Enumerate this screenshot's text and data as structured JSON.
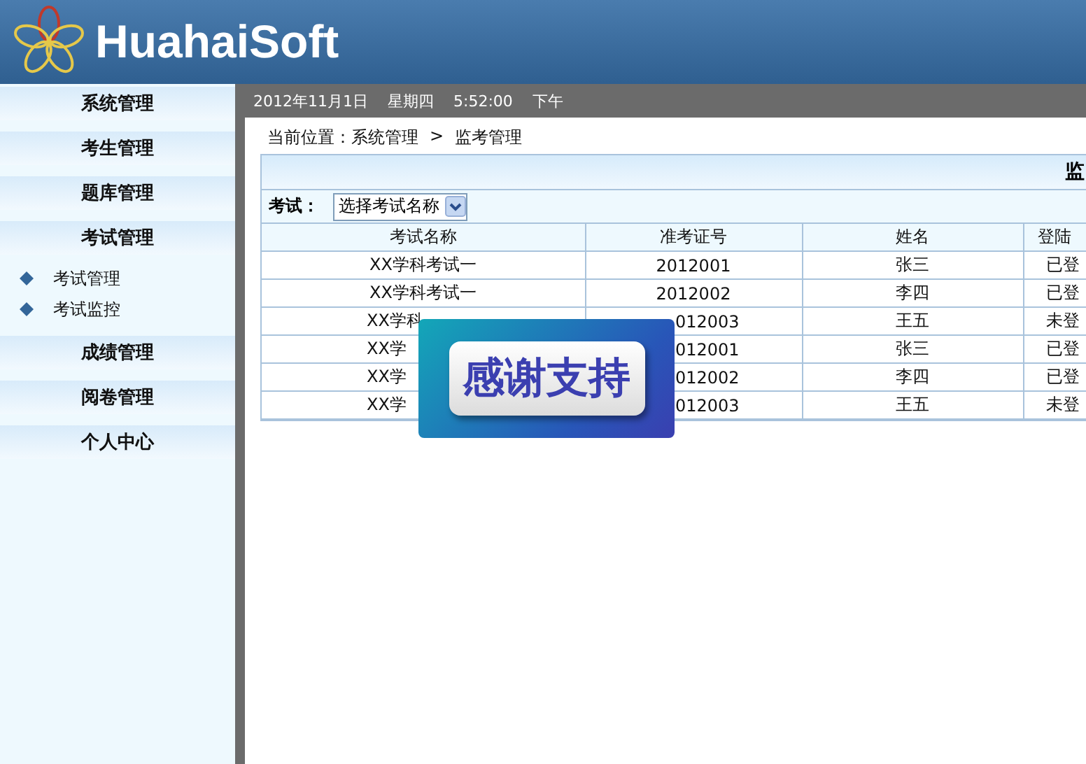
{
  "header": {
    "logo_text": "HuahaiSoft"
  },
  "sidebar": {
    "groups": [
      {
        "label": "系统管理"
      },
      {
        "label": "考生管理"
      },
      {
        "label": "题库管理"
      },
      {
        "label": "考试管理",
        "items": [
          "考试管理",
          "考试监控"
        ]
      },
      {
        "label": "成绩管理"
      },
      {
        "label": "阅卷管理"
      },
      {
        "label": "个人中心"
      }
    ]
  },
  "status_bar": {
    "date": "2012年11月1日",
    "weekday": "星期四",
    "time": "5:52:00",
    "period": "下午"
  },
  "breadcrumb": {
    "items": [
      "当前位置：系统管理",
      "监考管理"
    ],
    "separator": ">"
  },
  "panel": {
    "title": "监",
    "filter_label": "考试：",
    "filter_select": "选择考试名称",
    "columns": [
      "考试名称",
      "准考证号",
      "姓名",
      "登陆"
    ],
    "rows": [
      {
        "partly_hidden": false,
        "cells": [
          "XX学科考试一",
          "2012001",
          "张三",
          "已登"
        ]
      },
      {
        "partly_hidden": false,
        "cells": [
          "XX学科考试一",
          "2012002",
          "李四",
          "已登"
        ]
      },
      {
        "partly_hidden": true,
        "cells": [
          "XX学科",
          "012003",
          "王五",
          "未登"
        ]
      },
      {
        "partly_hidden": true,
        "cells": [
          "XX学",
          "012001",
          "张三",
          "已登"
        ]
      },
      {
        "partly_hidden": true,
        "cells": [
          "XX学",
          "012002",
          "李四",
          "已登"
        ]
      },
      {
        "partly_hidden": true,
        "cells": [
          "XX学",
          "012003",
          "王五",
          "未登"
        ]
      }
    ]
  },
  "overlay": {
    "text": "感谢支持"
  }
}
